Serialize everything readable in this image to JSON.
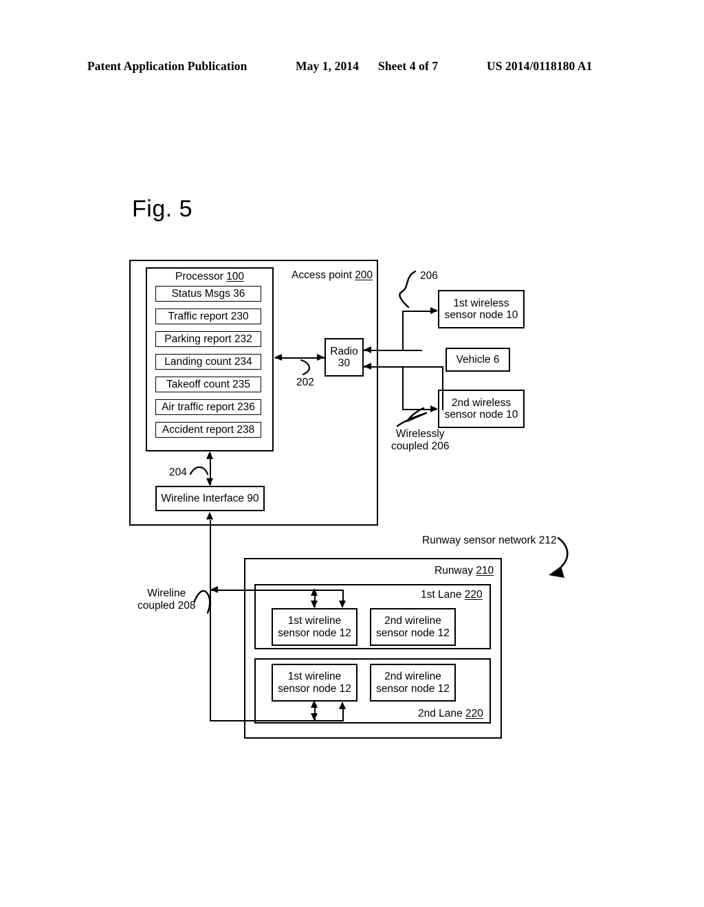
{
  "header": {
    "publication": "Patent Application Publication",
    "date": "May 1, 2014",
    "sheet": "Sheet 4 of 7",
    "patent_number": "US 2014/0118180 A1"
  },
  "figure": {
    "label": "Fig. 5"
  },
  "access_point": {
    "title_text": "Access point ",
    "title_ref": "200",
    "processor": {
      "title_text": "Processor ",
      "title_ref": "100",
      "items": [
        {
          "label": "Status Msgs 36"
        },
        {
          "label": "Traffic report 230"
        },
        {
          "label": "Parking report 232"
        },
        {
          "label": "Landing count 234"
        },
        {
          "label": "Takeoff count 235"
        },
        {
          "label": "Air traffic report 236"
        },
        {
          "label": "Accident report 238"
        }
      ]
    },
    "radio": {
      "line1": "Radio",
      "line2": "30"
    },
    "bus_202_label": "202",
    "bus_204_label": "204",
    "wireline_interface": "Wireline Interface 90"
  },
  "wireless": {
    "ref_206_top": "206",
    "node1_line1": "1st wireless",
    "node1_line2": "sensor node 10",
    "vehicle": "Vehicle 6",
    "node2_line1": "2nd wireless",
    "node2_line2": "sensor node 10",
    "coupled_line1": "Wirelessly",
    "coupled_line2": "coupled 206"
  },
  "runway": {
    "network_label": "Runway sensor network 212",
    "title_text": "Runway ",
    "title_ref": "210",
    "wireline_coupled_line1": "Wireline",
    "wireline_coupled_line2": "coupled 208",
    "lanes": [
      {
        "label_text": "1st Lane ",
        "label_ref": "220",
        "nodes": [
          {
            "line1": "1st wireline",
            "line2": "sensor node 12"
          },
          {
            "line1": "2nd wireline",
            "line2": "sensor node 12"
          }
        ]
      },
      {
        "label_text": "2nd Lane ",
        "label_ref": "220",
        "nodes": [
          {
            "line1": "1st wireline",
            "line2": "sensor node 12"
          },
          {
            "line1": "2nd wireline",
            "line2": "sensor node 12"
          }
        ]
      }
    ]
  },
  "colors": {
    "ink": "#000000",
    "paper": "#ffffff"
  }
}
